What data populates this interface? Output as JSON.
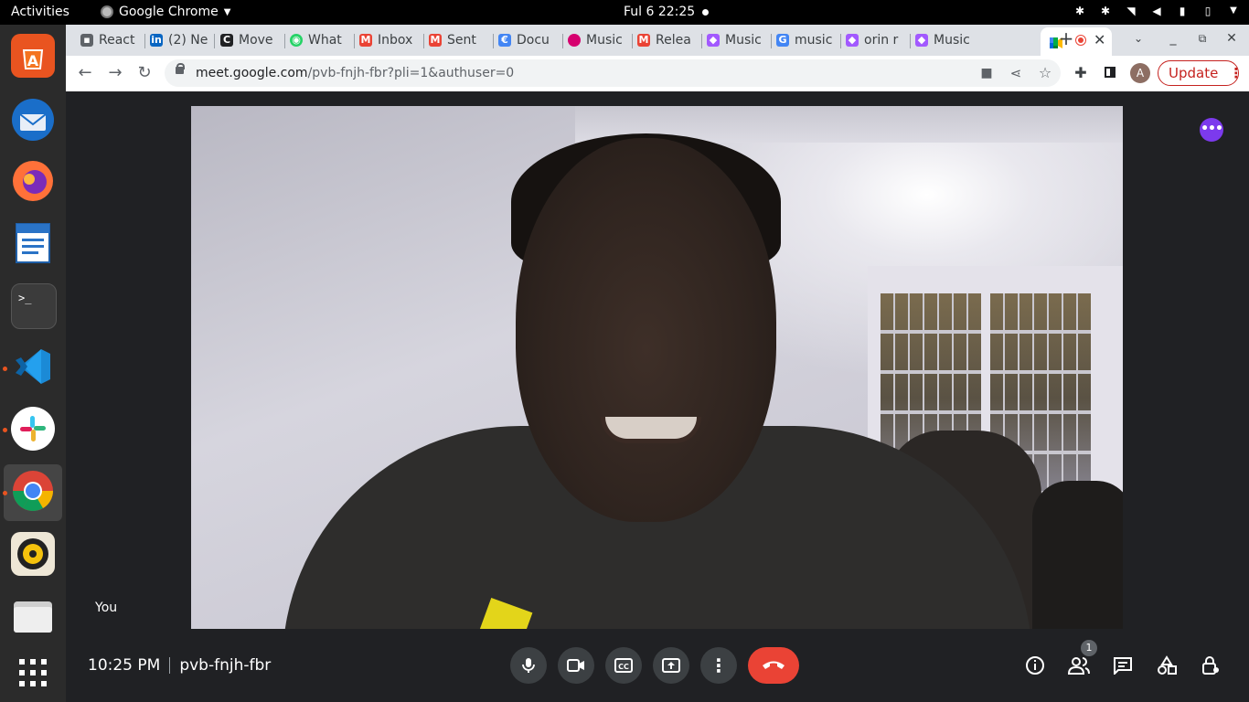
{
  "topbar": {
    "activities": "Activities",
    "app_name": "Google Chrome",
    "clock": "Ful 6  22:25"
  },
  "dock": {
    "apps": [
      "ubuntu-software",
      "thunderbird",
      "firefox",
      "libreoffice-writer",
      "terminal",
      "vscode",
      "slack",
      "chrome",
      "rhythmbox",
      "files",
      "show-applications"
    ]
  },
  "tabs": [
    {
      "label": "React",
      "icon": "film-icon",
      "color": "#5f6368"
    },
    {
      "label": "(2) Ne",
      "icon": "linkedin-icon",
      "color": "#0a66c2"
    },
    {
      "label": "Move",
      "icon": "c-icon",
      "color": "#202124"
    },
    {
      "label": "What",
      "icon": "whatsapp-icon",
      "color": "#25d366"
    },
    {
      "label": "Inbox",
      "icon": "gmail-icon",
      "color": "#ea4335"
    },
    {
      "label": "Sent",
      "icon": "gmail-icon",
      "color": "#ea4335"
    },
    {
      "label": "Docu",
      "icon": "e-icon",
      "color": "#4285f4"
    },
    {
      "label": "Music",
      "icon": "circle-icon",
      "color": "#d6006f"
    },
    {
      "label": "Relea",
      "icon": "mail-icon",
      "color": "#ea4335"
    },
    {
      "label": "Music",
      "icon": "figma-icon",
      "color": "#a259ff"
    },
    {
      "label": "music",
      "icon": "google-icon",
      "color": "#4285f4"
    },
    {
      "label": "orin r",
      "icon": "figma-icon",
      "color": "#a259ff"
    },
    {
      "label": "Music",
      "icon": "figma-icon",
      "color": "#a259ff"
    }
  ],
  "address_bar": {
    "host": "meet.google.com",
    "path": "/pvb-fnjh-fbr?pli=1&authuser=0"
  },
  "profile": {
    "initial": "A"
  },
  "update_label": "Update",
  "meet": {
    "self_label": "You",
    "time": "10:25 PM",
    "meeting_code": "pvb-fnjh-fbr",
    "participant_count": "1"
  }
}
